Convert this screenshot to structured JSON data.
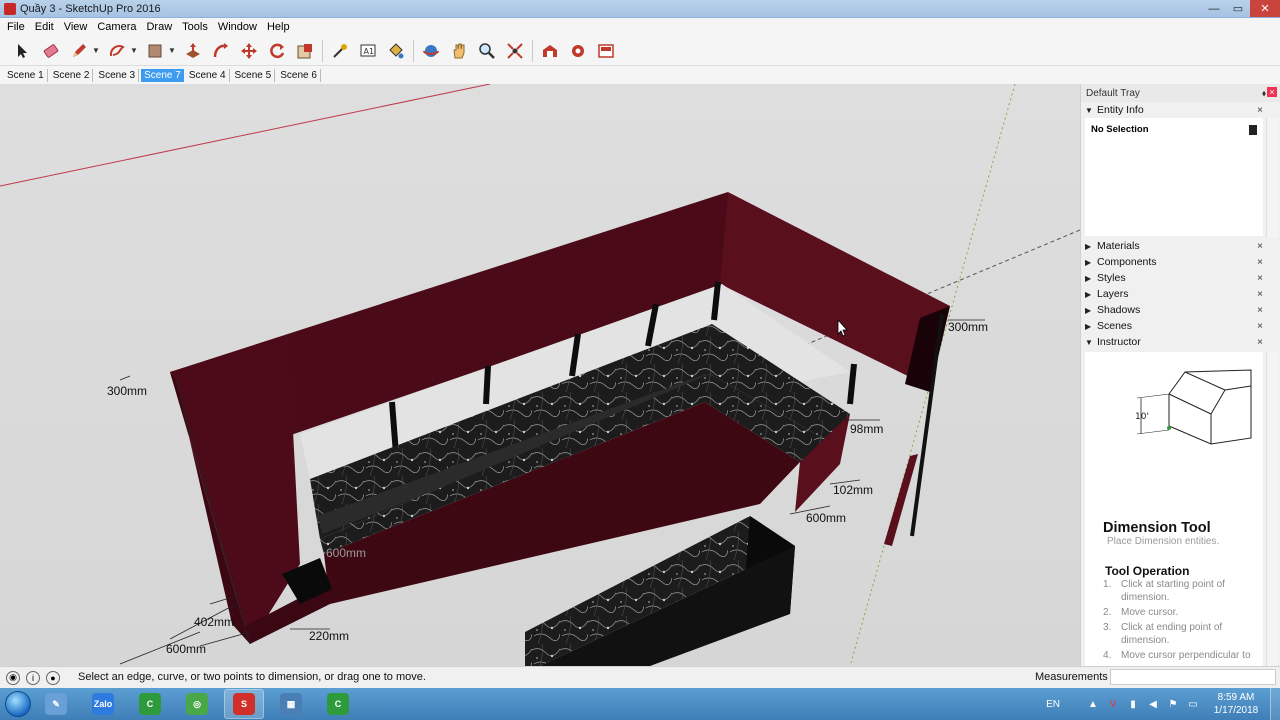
{
  "window": {
    "title": "Quầy 3 - SketchUp Pro 2016",
    "controls": {
      "minimize": "—",
      "maximize": "▭",
      "close": "✕"
    }
  },
  "menu": [
    "File",
    "Edit",
    "View",
    "Camera",
    "Draw",
    "Tools",
    "Window",
    "Help"
  ],
  "toolbar": {
    "tools": [
      {
        "name": "select-icon",
        "color": "#222222"
      },
      {
        "name": "eraser-icon",
        "color": "#e0607a"
      },
      {
        "name": "pencil-icon",
        "color": "#c0392b"
      },
      {
        "name": "shapes-icon",
        "color": "#c0392b"
      },
      {
        "name": "push-pull-icon",
        "color": "#a0522d"
      },
      {
        "name": "move-icon",
        "color": "#c0392b"
      },
      {
        "name": "rotate-icon",
        "color": "#c0392b"
      },
      {
        "name": "scale-icon",
        "color": "#c0392b"
      },
      {
        "name": "offset-icon",
        "color": "#c0392b"
      },
      {
        "name": "tape-measure-icon",
        "color": "#c79a00"
      },
      {
        "name": "text-icon",
        "color": "#333333"
      },
      {
        "name": "paint-bucket-icon",
        "color": "#3a78c4"
      },
      {
        "name": "orbit-icon",
        "color": "#c0392b"
      },
      {
        "name": "pan-icon",
        "color": "#d4a020"
      },
      {
        "name": "zoom-icon",
        "color": "#333333"
      },
      {
        "name": "zoom-extents-icon",
        "color": "#c0392b"
      },
      {
        "name": "warehouse-icon",
        "color": "#c0392b"
      },
      {
        "name": "extension-warehouse-icon",
        "color": "#c0392b"
      },
      {
        "name": "layout-icon",
        "color": "#c0392b"
      }
    ]
  },
  "scenes": [
    "Scene 1",
    "Scene 2",
    "Scene 3",
    "Scene 7",
    "Scene 4",
    "Scene 5",
    "Scene 6"
  ],
  "active_scene": "Scene 7",
  "viewport": {
    "dimensions": [
      {
        "label": "300mm",
        "style": "normal"
      },
      {
        "label": "300mm",
        "style": "normal"
      },
      {
        "label": "98mm",
        "style": "normal"
      },
      {
        "label": "102mm",
        "style": "normal"
      },
      {
        "label": "600mm",
        "style": "normal"
      },
      {
        "label": "600mm",
        "style": "faded"
      },
      {
        "label": "402mm",
        "style": "normal"
      },
      {
        "label": "220mm",
        "style": "normal"
      },
      {
        "label": "600mm",
        "style": "normal"
      }
    ],
    "colors": {
      "cabinet": "#5a0f1c",
      "cabinet_dark": "#3d0812",
      "marble": "#1e1e1e",
      "background": "#dcdcdc"
    }
  },
  "tray": {
    "title": "Default Tray",
    "entity_info": {
      "label": "Entity Info",
      "selection": "No Selection"
    },
    "panels": [
      "Materials",
      "Components",
      "Styles",
      "Layers",
      "Shadows",
      "Scenes",
      "Instructor"
    ],
    "instructor": {
      "dimension_label": "10'",
      "tool_name": "Dimension Tool",
      "tool_desc": "Place Dimension entities.",
      "operation_heading": "Tool Operation",
      "steps": [
        {
          "num": "1.",
          "text": "Click at starting point of dimension."
        },
        {
          "num": "2.",
          "text": "Move cursor."
        },
        {
          "num": "3.",
          "text": "Click at ending point of dimension."
        },
        {
          "num": "4.",
          "text": "Move cursor perpendicular to"
        }
      ]
    }
  },
  "status": {
    "message": "Select an edge, curve, or two points to dimension, or drag one to move.",
    "measurements_label": "Measurements",
    "measurements_value": ""
  },
  "taskbar": {
    "apps": [
      {
        "name": "start-orb"
      },
      {
        "name": "paint-app-icon",
        "glyph": "✎",
        "color": "#6aa0d8"
      },
      {
        "name": "zalo-app-icon",
        "glyph": "Zalo",
        "color": "#2d7be0"
      },
      {
        "name": "camtasia-app-icon",
        "glyph": "C",
        "color": "#2e9a3c"
      },
      {
        "name": "recorder-app-icon",
        "glyph": "◎",
        "color": "#48a848"
      },
      {
        "name": "sketchup-app-icon",
        "glyph": "S",
        "color": "#d0302a"
      },
      {
        "name": "explorer-app-icon",
        "glyph": "▦",
        "color": "#4a7fb5"
      },
      {
        "name": "camtasia2-app-icon",
        "glyph": "C",
        "color": "#2e9a3c"
      }
    ],
    "language": "EN",
    "time": "8:59 AM",
    "date": "1/17/2018"
  }
}
